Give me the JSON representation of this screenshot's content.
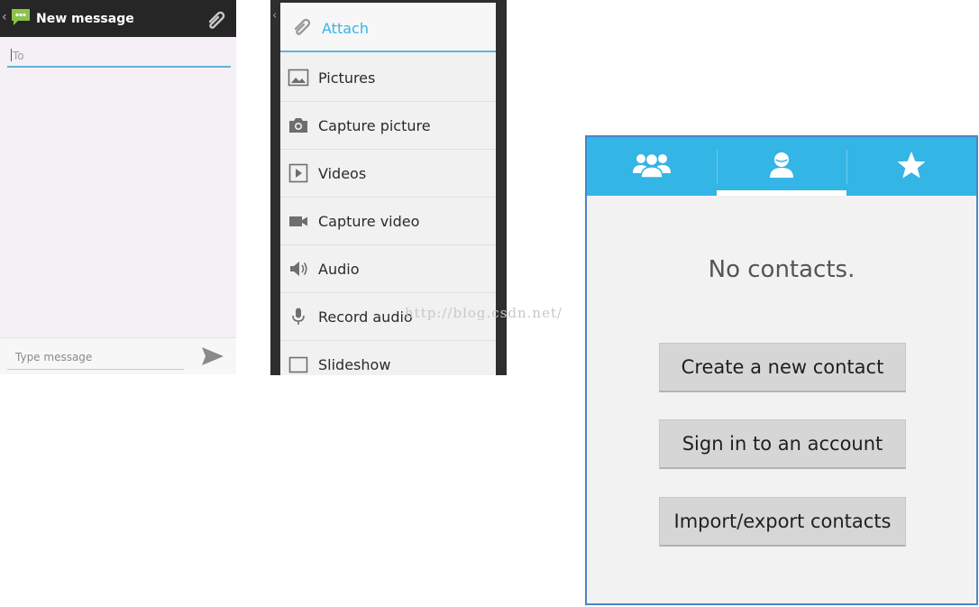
{
  "new_message": {
    "title": "New message",
    "back_glyph": "‹",
    "to_placeholder": "To",
    "message_placeholder": "Type message",
    "icons": {
      "app": "messaging-icon",
      "attach": "paperclip-icon",
      "send": "send-icon"
    }
  },
  "attach_menu": {
    "edge_glyph": "‹",
    "header": {
      "label": "Attach",
      "icon": "paperclip-icon"
    },
    "items": [
      {
        "label": "Pictures",
        "icon": "picture-icon"
      },
      {
        "label": "Capture picture",
        "icon": "camera-icon"
      },
      {
        "label": "Videos",
        "icon": "video-icon"
      },
      {
        "label": "Capture video",
        "icon": "video-camera-icon"
      },
      {
        "label": "Audio",
        "icon": "speaker-icon"
      },
      {
        "label": "Record audio",
        "icon": "microphone-icon"
      },
      {
        "label": "Slideshow",
        "icon": "slideshow-icon"
      }
    ]
  },
  "contacts": {
    "tabs": [
      {
        "icon": "groups-icon",
        "selected": false
      },
      {
        "icon": "person-icon",
        "selected": true
      },
      {
        "icon": "star-icon",
        "selected": false
      }
    ],
    "empty_text": "No contacts.",
    "buttons": {
      "create": "Create a new contact",
      "signin": "Sign in to an account",
      "import_export": "Import/export contacts"
    },
    "colors": {
      "tab_bar": "#33b5e5",
      "accent": "#33b5e5"
    }
  },
  "watermark": "http://blog.csdn.net/"
}
